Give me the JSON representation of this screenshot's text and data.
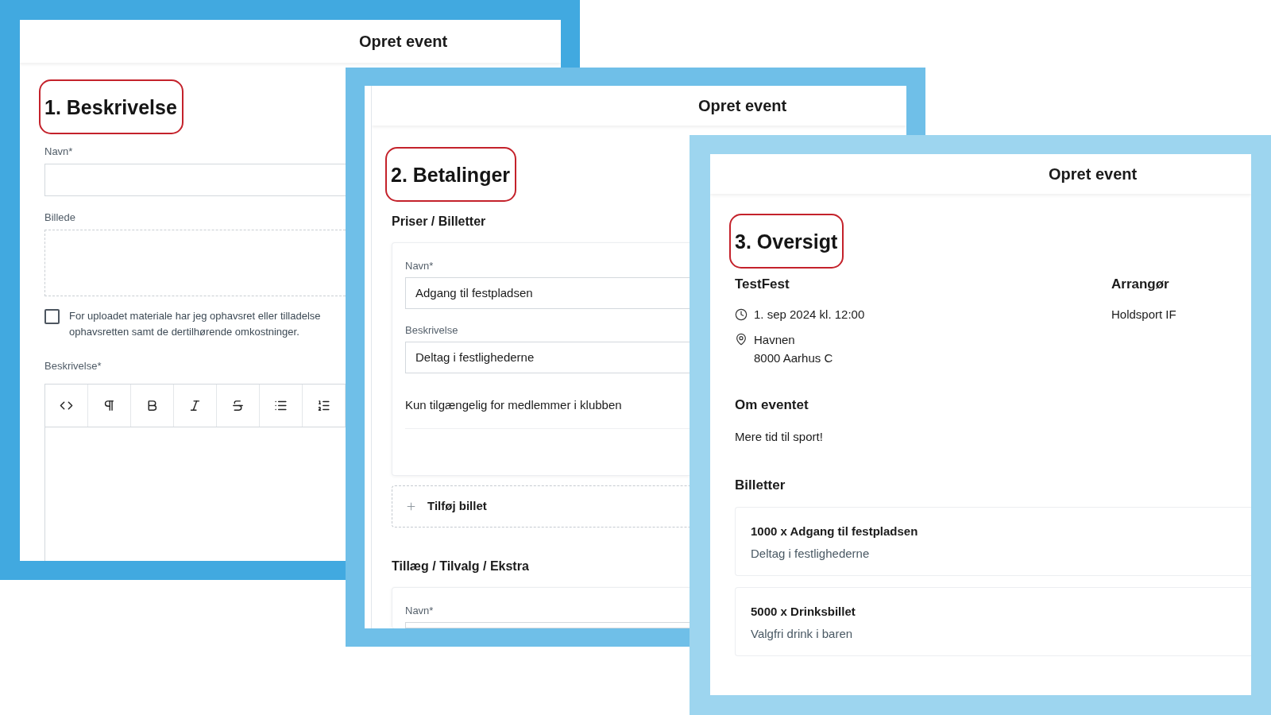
{
  "panels": [
    {
      "kind": "description",
      "title": "Opret event",
      "step_heading": "1. Beskrivelse",
      "name_field": {
        "label": "Navn*"
      },
      "image_field": {
        "label": "Billede"
      },
      "consent": {
        "checked": false,
        "lines": [
          "For uploadet materiale har jeg ophavsret eller tilladelse",
          "ophavsretten samt de dertilhørende omkostninger."
        ]
      },
      "description_field": {
        "label": "Beskrivelse*",
        "toolbar": [
          {
            "kind": "code"
          },
          {
            "kind": "paragraph"
          },
          {
            "kind": "bold"
          },
          {
            "kind": "italic"
          },
          {
            "kind": "strikethrough"
          },
          {
            "kind": "bullet_list"
          },
          {
            "kind": "numbered_list"
          }
        ]
      }
    },
    {
      "kind": "payments",
      "title": "Opret event",
      "step_heading": "2. Betalinger",
      "sections": [
        {
          "heading": "Priser / Billetter",
          "fields": [
            {
              "label": "Navn*",
              "value": "Adgang til festpladsen"
            },
            {
              "label": "Beskrivelse",
              "value": "Deltag i festlighederne"
            }
          ],
          "option": "Kun tilgængelig for medlemmer i klubben",
          "add_button": "Tilføj billet"
        },
        {
          "heading": "Tillæg / Tilvalg / Ekstra",
          "fields": [
            {
              "label": "Navn*"
            }
          ]
        }
      ]
    },
    {
      "kind": "overview",
      "title": "Opret event",
      "step_heading": "3. Oversigt",
      "event_name": "TestFest",
      "date": "1. sep 2024 kl. 12:00",
      "address": [
        "Havnen",
        "8000 Aarhus C"
      ],
      "organizer": {
        "heading": "Arrangør",
        "name": "Holdsport IF"
      },
      "about": {
        "heading": "Om eventet",
        "text": "Mere tid til sport!"
      },
      "tickets": {
        "heading": "Billetter",
        "items": [
          {
            "title": "1000 x Adgang til festpladsen",
            "description": "Deltag i festlighederne"
          },
          {
            "title": "5000 x Drinksbillet",
            "description": "Valgfri drink i baren"
          }
        ]
      }
    }
  ]
}
